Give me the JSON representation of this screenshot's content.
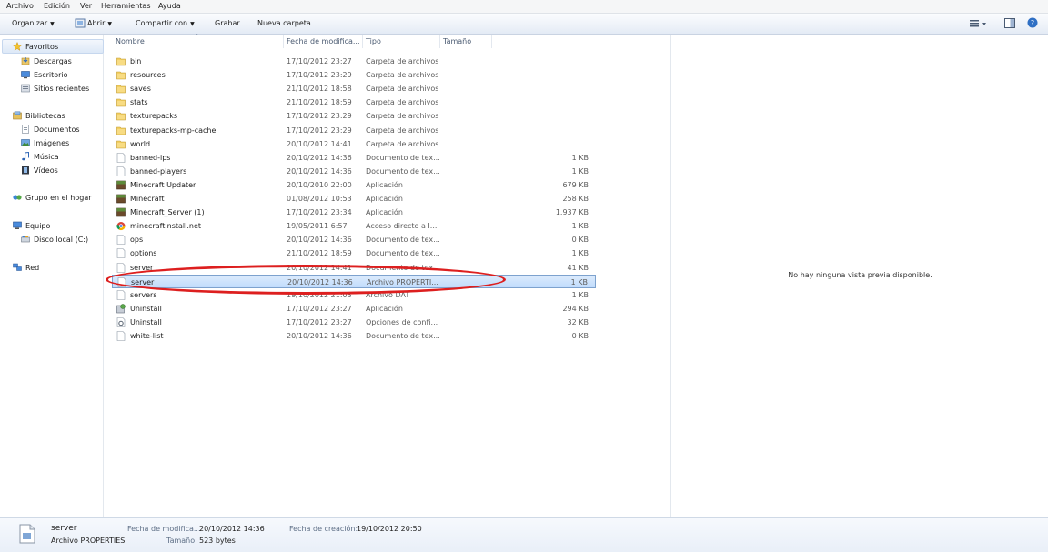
{
  "menu": [
    "Archivo",
    "Edición",
    "Ver",
    "Herramientas",
    "Ayuda"
  ],
  "toolbar": {
    "organize": "Organizar",
    "open": "Abrir",
    "share": "Compartir con",
    "burn": "Grabar",
    "new_folder": "Nueva carpeta"
  },
  "nav": {
    "favorites": "Favoritos",
    "downloads": "Descargas",
    "desktop": "Escritorio",
    "recent": "Sitios recientes",
    "libraries": "Bibliotecas",
    "documents": "Documentos",
    "pictures": "Imágenes",
    "music": "Música",
    "videos": "Vídeos",
    "homegroup": "Grupo en el hogar",
    "computer": "Equipo",
    "local_disk": "Disco local (C:)",
    "network": "Red"
  },
  "columns": {
    "name": "Nombre",
    "date": "Fecha de modifica...",
    "type": "Tipo",
    "size": "Tamaño"
  },
  "files": [
    {
      "name": "bin",
      "date": "17/10/2012 23:27",
      "type": "Carpeta de archivos",
      "size": "",
      "icon": "folder"
    },
    {
      "name": "resources",
      "date": "17/10/2012 23:29",
      "type": "Carpeta de archivos",
      "size": "",
      "icon": "folder"
    },
    {
      "name": "saves",
      "date": "21/10/2012 18:58",
      "type": "Carpeta de archivos",
      "size": "",
      "icon": "folder"
    },
    {
      "name": "stats",
      "date": "21/10/2012 18:59",
      "type": "Carpeta de archivos",
      "size": "",
      "icon": "folder"
    },
    {
      "name": "texturepacks",
      "date": "17/10/2012 23:29",
      "type": "Carpeta de archivos",
      "size": "",
      "icon": "folder"
    },
    {
      "name": "texturepacks-mp-cache",
      "date": "17/10/2012 23:29",
      "type": "Carpeta de archivos",
      "size": "",
      "icon": "folder"
    },
    {
      "name": "world",
      "date": "20/10/2012 14:41",
      "type": "Carpeta de archivos",
      "size": "",
      "icon": "folder"
    },
    {
      "name": "banned-ips",
      "date": "20/10/2012 14:36",
      "type": "Documento de tex...",
      "size": "1 KB",
      "icon": "doc"
    },
    {
      "name": "banned-players",
      "date": "20/10/2012 14:36",
      "type": "Documento de tex...",
      "size": "1 KB",
      "icon": "doc"
    },
    {
      "name": "Minecraft Updater",
      "date": "20/10/2010 22:00",
      "type": "Aplicación",
      "size": "679 KB",
      "icon": "minecraft"
    },
    {
      "name": "Minecraft",
      "date": "01/08/2012 10:53",
      "type": "Aplicación",
      "size": "258 KB",
      "icon": "minecraft"
    },
    {
      "name": "Minecraft_Server (1)",
      "date": "17/10/2012 23:34",
      "type": "Aplicación",
      "size": "1.937 KB",
      "icon": "minecraft"
    },
    {
      "name": "minecraftinstall.net",
      "date": "19/05/2011 6:57",
      "type": "Acceso directo a I...",
      "size": "1 KB",
      "icon": "chrome"
    },
    {
      "name": "ops",
      "date": "20/10/2012 14:36",
      "type": "Documento de tex...",
      "size": "0 KB",
      "icon": "doc"
    },
    {
      "name": "options",
      "date": "21/10/2012 18:59",
      "type": "Documento de tex...",
      "size": "1 KB",
      "icon": "doc"
    },
    {
      "name": "server",
      "date": "20/10/2012 14:41",
      "type": "Documento de tex...",
      "size": "41 KB",
      "icon": "doc"
    },
    {
      "name": "server",
      "date": "20/10/2012 14:36",
      "type": "Archivo PROPERTI...",
      "size": "1 KB",
      "icon": "doc"
    },
    {
      "name": "servers",
      "date": "19/10/2012 21:03",
      "type": "Archivo DAT",
      "size": "1 KB",
      "icon": "doc"
    },
    {
      "name": "Uninstall",
      "date": "17/10/2012 23:27",
      "type": "Aplicación",
      "size": "294 KB",
      "icon": "setup"
    },
    {
      "name": "Uninstall",
      "date": "17/10/2012 23:27",
      "type": "Opciones de confi...",
      "size": "32 KB",
      "icon": "gear"
    },
    {
      "name": "white-list",
      "date": "20/10/2012 14:36",
      "type": "Documento de tex...",
      "size": "0 KB",
      "icon": "doc"
    }
  ],
  "selected_index": 16,
  "preview": {
    "message": "No hay ninguna vista previa disponible."
  },
  "details": {
    "name": "server",
    "type": "Archivo PROPERTIES",
    "modified_label": "Fecha de modifica...",
    "modified_value": "20/10/2012 14:36",
    "created_label": "Fecha de creación:",
    "created_value": "19/10/2012 20:50",
    "size_label": "Tamaño:",
    "size_value": "523 bytes"
  },
  "colors": {
    "highlight_circle": "#dd1f1f",
    "selection": "#c1dcfc"
  }
}
